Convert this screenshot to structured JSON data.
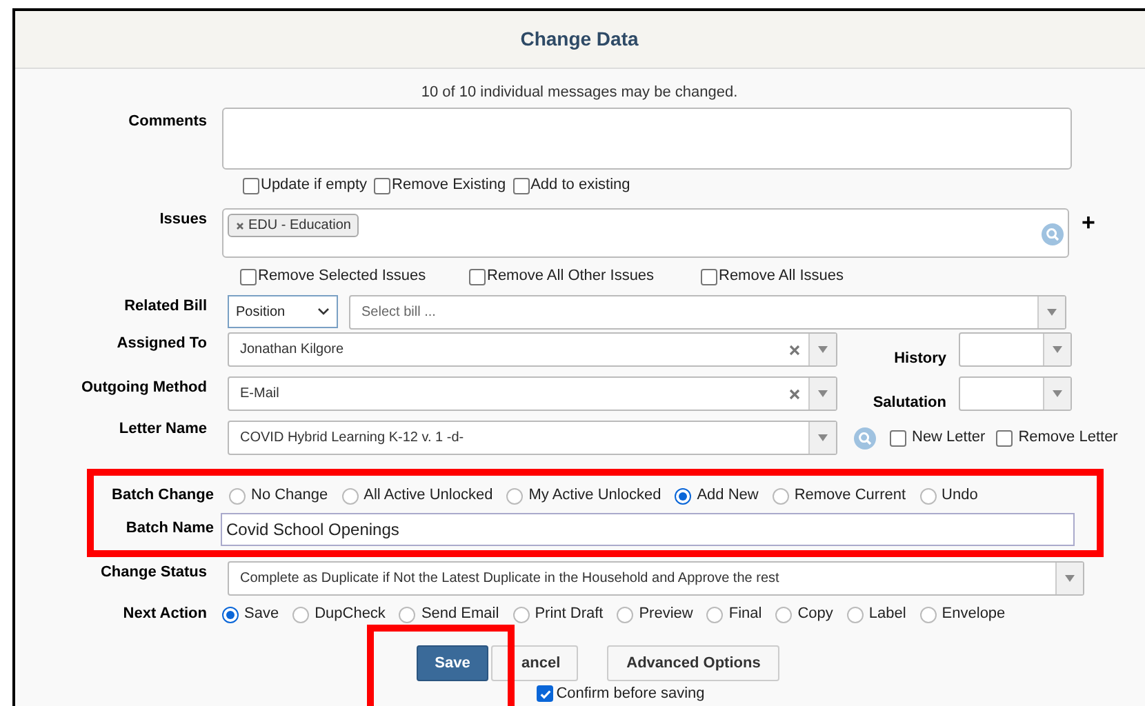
{
  "dialog": {
    "title": "Change Data",
    "summary": "10 of 10 individual messages may be changed."
  },
  "comments": {
    "label": "Comments",
    "options": [
      {
        "label": "Update if empty",
        "checked": false
      },
      {
        "label": "Remove Existing",
        "checked": false
      },
      {
        "label": "Add to existing",
        "checked": false
      }
    ]
  },
  "issues": {
    "label": "Issues",
    "tags": [
      "EDU - Education"
    ],
    "add": "+",
    "options": [
      {
        "label": "Remove Selected Issues",
        "checked": false
      },
      {
        "label": "Remove All Other Issues",
        "checked": false
      },
      {
        "label": "Remove All Issues",
        "checked": false
      }
    ]
  },
  "related_bill": {
    "label": "Related Bill",
    "type": "Position",
    "placeholder": "Select bill ..."
  },
  "assigned_to": {
    "label": "Assigned To",
    "value": "Jonathan Kilgore",
    "side_label": "History"
  },
  "outgoing_method": {
    "label": "Outgoing Method",
    "value": "E-Mail",
    "side_label": "Salutation"
  },
  "letter_name": {
    "label": "Letter Name",
    "value": "COVID Hybrid Learning K-12 v. 1 -d-",
    "options": [
      {
        "label": "New Letter",
        "checked": false
      },
      {
        "label": "Remove Letter",
        "checked": false
      }
    ]
  },
  "batch": {
    "highlighted": true,
    "change_label": "Batch Change",
    "choices": [
      {
        "label": "No Change",
        "selected": false
      },
      {
        "label": "All Active Unlocked",
        "selected": false
      },
      {
        "label": "My Active Unlocked",
        "selected": false
      },
      {
        "label": "Add New",
        "selected": true
      },
      {
        "label": "Remove Current",
        "selected": false
      },
      {
        "label": "Undo",
        "selected": false
      }
    ],
    "name_label": "Batch Name",
    "name": "Covid School Openings"
  },
  "change_status": {
    "label": "Change Status",
    "value": "Complete as Duplicate if Not the Latest Duplicate in the Household and Approve the rest"
  },
  "next_action": {
    "label": "Next Action",
    "choices": [
      {
        "label": "Save",
        "selected": true
      },
      {
        "label": "DupCheck",
        "selected": false
      },
      {
        "label": "Send Email",
        "selected": false
      },
      {
        "label": "Print Draft",
        "selected": false
      },
      {
        "label": "Preview",
        "selected": false
      },
      {
        "label": "Final",
        "selected": false
      },
      {
        "label": "Copy",
        "selected": false
      },
      {
        "label": "Label",
        "selected": false
      },
      {
        "label": "Envelope",
        "selected": false
      }
    ]
  },
  "buttons": [
    {
      "label": "Save",
      "kind": "primary"
    },
    {
      "label": "ancel",
      "kind": "default"
    },
    {
      "label": "Advanced Options",
      "kind": "default"
    }
  ],
  "save_highlighted": true,
  "confirm": {
    "label": "Confirm before saving",
    "checked": true
  }
}
